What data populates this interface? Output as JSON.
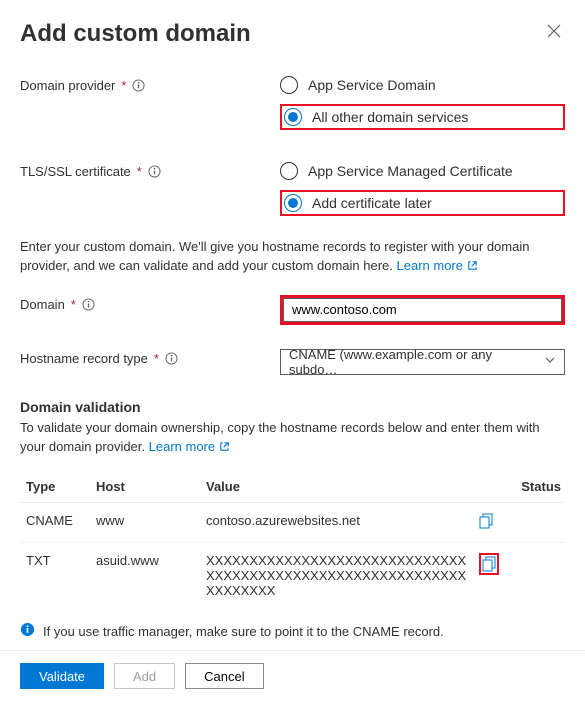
{
  "header": {
    "title": "Add custom domain"
  },
  "fields": {
    "domain_provider": {
      "label": "Domain provider",
      "options": {
        "app_service": "App Service Domain",
        "other": "All other domain services"
      }
    },
    "tls": {
      "label": "TLS/SSL certificate",
      "options": {
        "managed": "App Service Managed Certificate",
        "later": "Add certificate later"
      }
    },
    "intro_para_a": "Enter your custom domain. We'll give you hostname records to register with your domain provider, and we can validate and add your custom domain here. ",
    "learn_more": "Learn more",
    "domain": {
      "label": "Domain",
      "value": "www.contoso.com"
    },
    "record_type": {
      "label": "Hostname record type",
      "selected": "CNAME (www.example.com or any subdo…"
    }
  },
  "validation": {
    "heading": "Domain validation",
    "para_a": "To validate your domain ownership, copy the hostname records below and enter them with your domain provider. ",
    "learn_more": "Learn more",
    "columns": {
      "type": "Type",
      "host": "Host",
      "value": "Value",
      "status": "Status"
    },
    "rows": [
      {
        "type": "CNAME",
        "host": "www",
        "value": "contoso.azurewebsites.net"
      },
      {
        "type": "TXT",
        "host": "asuid.www",
        "value": "XXXXXXXXXXXXXXXXXXXXXXXXXXXXXXXXXXXXXXXXXXXXXXXXXXXXXXXXXXXXXXXXXXXX"
      }
    ]
  },
  "note": "If you use traffic manager, make sure to point it to the CNAME record.",
  "footer": {
    "validate": "Validate",
    "add": "Add",
    "cancel": "Cancel"
  }
}
